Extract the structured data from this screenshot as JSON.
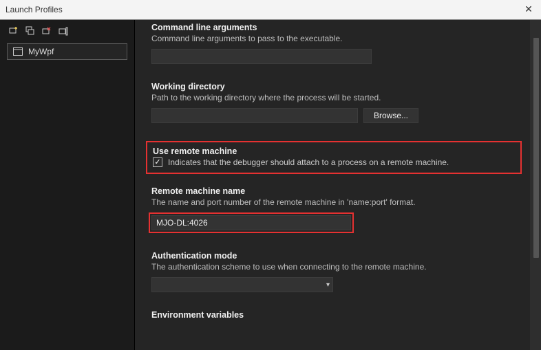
{
  "window": {
    "title": "Launch Profiles"
  },
  "sidebar": {
    "profile_label": "MyWpf"
  },
  "sections": {
    "cli": {
      "title": "Command line arguments",
      "desc": "Command line arguments to pass to the executable.",
      "value": ""
    },
    "wd": {
      "title": "Working directory",
      "desc": "Path to the working directory where the process will be started.",
      "value": "",
      "browse_label": "Browse..."
    },
    "remote_chk": {
      "title": "Use remote machine",
      "label": "Indicates that the debugger should attach to a process on a remote machine."
    },
    "remote_name": {
      "title": "Remote machine name",
      "desc": "The name and port number of the remote machine in 'name:port' format.",
      "value": "MJO-DL:4026"
    },
    "auth": {
      "title": "Authentication mode",
      "desc": "The authentication scheme to use when connecting to the remote machine.",
      "selected": ""
    },
    "env": {
      "title": "Environment variables"
    }
  }
}
